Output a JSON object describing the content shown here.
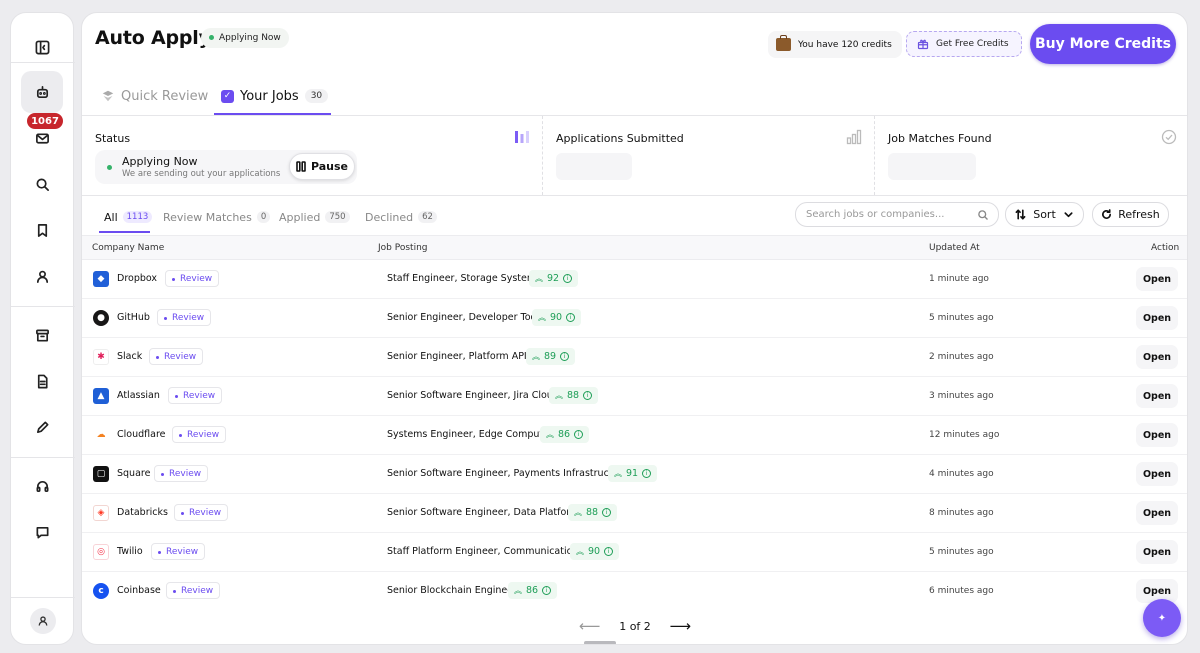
{
  "header": {
    "title": "Auto Apply",
    "status": "Applying Now",
    "credits_text": "You have 120 credits",
    "free_credits": "Get Free Credits",
    "buy_credits": "Buy More Credits"
  },
  "sidebar": {
    "badge": "1067",
    "items": [
      "collapse-sidebar",
      "auto-apply",
      "inbox",
      "search",
      "saved",
      "profile",
      "archive",
      "documents",
      "edit",
      "support",
      "messages"
    ]
  },
  "tabs": [
    {
      "label": "Quick Review"
    },
    {
      "label": "Your Jobs",
      "count": "30"
    }
  ],
  "stats": {
    "status_label": "Status",
    "applying_title": "Applying Now",
    "applying_sub": "We are sending out your applications",
    "pause_label": "Pause",
    "submitted_label": "Applications Submitted",
    "matches_label": "Job Matches Found"
  },
  "filters": [
    {
      "label": "All",
      "count": "1113"
    },
    {
      "label": "Review Matches",
      "count": "0"
    },
    {
      "label": "Applied",
      "count": "750"
    },
    {
      "label": "Declined",
      "count": "62"
    }
  ],
  "search": {
    "placeholder": "Search jobs or companies..."
  },
  "sort_label": "Sort",
  "refresh_label": "Refresh",
  "table": {
    "headers": {
      "company": "Company Name",
      "job": "Job Posting",
      "updated": "Updated At",
      "action": "Action"
    },
    "rows": [
      {
        "company": "Dropbox",
        "status": "Review",
        "job": "Staff Engineer, Storage Systems",
        "score": "92",
        "updated": "1 minute ago",
        "action": "Open",
        "logo_color": "#2160d8"
      },
      {
        "company": "GitHub",
        "status": "Review",
        "job": "Senior Engineer, Developer Tools",
        "score": "90",
        "updated": "5 minutes ago",
        "action": "Open",
        "logo_color": "#181717"
      },
      {
        "company": "Slack",
        "status": "Review",
        "job": "Senior Engineer, Platform API",
        "score": "89",
        "updated": "2 minutes ago",
        "action": "Open",
        "logo_color": "#e01e5a"
      },
      {
        "company": "Atlassian",
        "status": "Review",
        "job": "Senior Software Engineer, Jira Cloud",
        "score": "88",
        "updated": "3 minutes ago",
        "action": "Open",
        "logo_color": "#1f5fd6"
      },
      {
        "company": "Cloudflare",
        "status": "Review",
        "job": "Systems Engineer, Edge Computing",
        "score": "86",
        "updated": "12 minutes ago",
        "action": "Open",
        "logo_color": "#f48120"
      },
      {
        "company": "Square",
        "status": "Review",
        "job": "Senior Software Engineer, Payments Infrastructure",
        "score": "91",
        "updated": "4 minutes ago",
        "action": "Open",
        "logo_color": "#111111"
      },
      {
        "company": "Databricks",
        "status": "Review",
        "job": "Senior Software Engineer, Data Platform",
        "score": "88",
        "updated": "8 minutes ago",
        "action": "Open",
        "logo_color": "#ff3621"
      },
      {
        "company": "Twilio",
        "status": "Review",
        "job": "Staff Platform Engineer, Communications",
        "score": "90",
        "updated": "5 minutes ago",
        "action": "Open",
        "logo_color": "#f22f46"
      },
      {
        "company": "Coinbase",
        "status": "Review",
        "job": "Senior Blockchain Engineer",
        "score": "86",
        "updated": "6 minutes ago",
        "action": "Open",
        "logo_color": "#1652f0"
      }
    ]
  },
  "pagination": {
    "label": "1 of 2"
  },
  "colors": {
    "accent": "#6b4cf0",
    "success": "#35b26a",
    "badge": "#c7262c"
  }
}
